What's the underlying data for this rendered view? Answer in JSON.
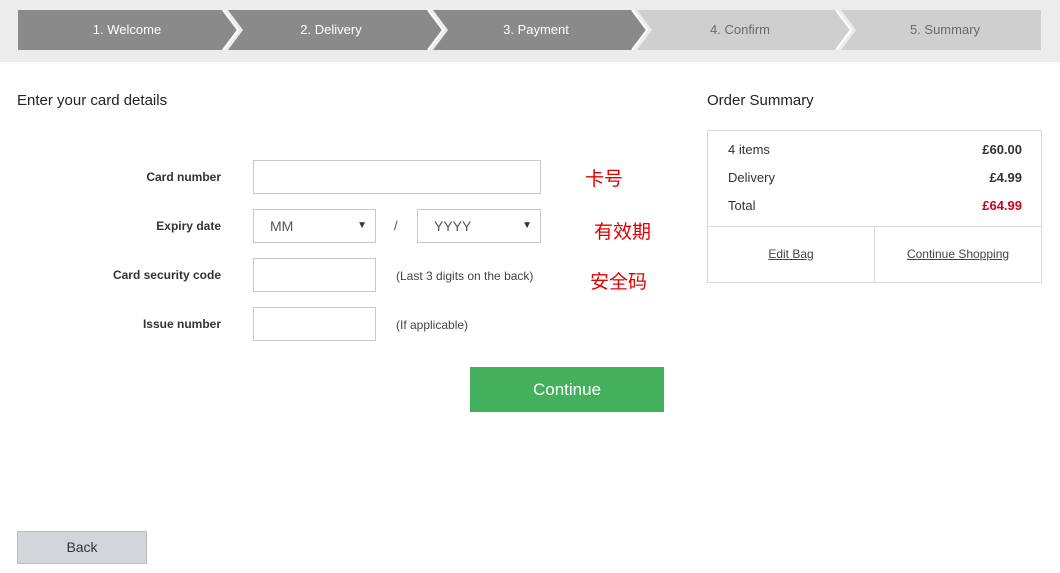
{
  "steps": [
    {
      "label": "1. Welcome",
      "state": "done"
    },
    {
      "label": "2. Delivery",
      "state": "done"
    },
    {
      "label": "3. Payment",
      "state": "current"
    },
    {
      "label": "4. Confirm",
      "state": "todo"
    },
    {
      "label": "5. Summary",
      "state": "todo"
    }
  ],
  "colors": {
    "step_done": "#8a8a8a",
    "step_todo": "#cfcfcf",
    "continue": "#43b05c",
    "total_red": "#d0021b",
    "annotation_red": "#e00000"
  },
  "card_form": {
    "title": "Enter your card details",
    "card_number_label": "Card number",
    "card_number_value": "",
    "expiry_label": "Expiry date",
    "expiry_month": "MM",
    "expiry_separator": "/",
    "expiry_year": "YYYY",
    "security_label": "Card security code",
    "security_value": "",
    "security_hint": "(Last 3 digits on the back)",
    "issue_label": "Issue number",
    "issue_value": "",
    "issue_hint": "(If applicable)",
    "continue_label": "Continue",
    "back_label": "Back"
  },
  "annotations": {
    "card_number": "卡号",
    "expiry": "有效期",
    "security": "安全码"
  },
  "order_summary": {
    "title": "Order Summary",
    "rows": [
      {
        "label": "4 items",
        "value": "£60.00"
      },
      {
        "label": "Delivery",
        "value": "£4.99"
      },
      {
        "label": "Total",
        "value": "£64.99"
      }
    ],
    "edit_bag_label": "Edit Bag",
    "continue_shopping_label": "Continue Shopping"
  }
}
